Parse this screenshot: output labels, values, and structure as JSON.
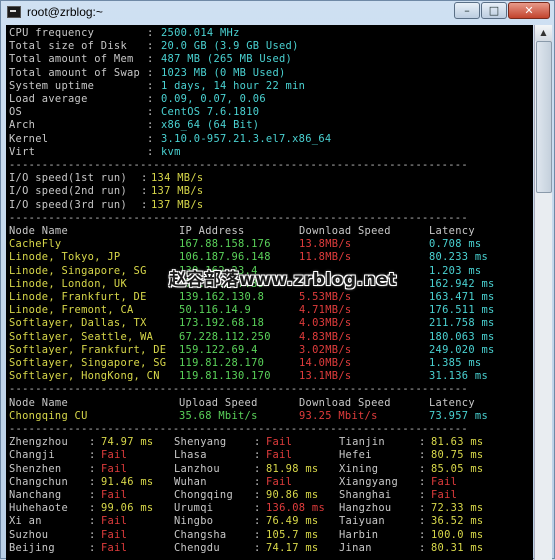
{
  "window": {
    "title": "root@zrblog:~"
  },
  "controls": {
    "minimize": "–",
    "maximize": "□",
    "close": "✕"
  },
  "sysinfo": [
    {
      "label": "CPU frequency",
      "value": "2500.014 MHz"
    },
    {
      "label": "Total size of Disk",
      "value": "20.0 GB (3.9 GB Used)"
    },
    {
      "label": "Total amount of Mem",
      "value": "487 MB (265 MB Used)"
    },
    {
      "label": "Total amount of Swap",
      "value": "1023 MB (0 MB Used)"
    },
    {
      "label": "System uptime",
      "value": "1 days, 14 hour 22 min"
    },
    {
      "label": "Load average",
      "value": "0.09, 0.07, 0.06"
    },
    {
      "label": "OS",
      "value": "CentOS 7.6.1810"
    },
    {
      "label": "Arch",
      "value": "x86_64 (64 Bit)"
    },
    {
      "label": "Kernel",
      "value": "3.10.0-957.21.3.el7.x86_64"
    },
    {
      "label": "Virt",
      "value": "kvm"
    }
  ],
  "separator": "----------------------------------------------------------------------",
  "io": [
    {
      "label": "I/O speed(1st run)",
      "value": "134 MB/s"
    },
    {
      "label": "I/O speed(2nd run)",
      "value": "137 MB/s"
    },
    {
      "label": "I/O speed(3rd run)",
      "value": "137 MB/s"
    }
  ],
  "speedtest": {
    "headers": [
      "Node Name",
      "IP Address",
      "Download Speed",
      "Latency"
    ],
    "rows": [
      [
        "CacheFly",
        "167.88.158.176",
        "13.8MB/s",
        "0.708 ms"
      ],
      [
        "Linode, Tokyo, JP",
        "106.187.96.148",
        "11.8MB/s",
        "80.233 ms"
      ],
      [
        "Linode, Singapore, SG",
        "139.162.23.4",
        "",
        "1.203 ms"
      ],
      [
        "Linode, London, UK",
        "176.58.107.39",
        "",
        "162.942 ms"
      ],
      [
        "Linode, Frankfurt, DE",
        "139.162.130.8",
        "5.53MB/s",
        "163.471 ms"
      ],
      [
        "Linode, Fremont, CA",
        "50.116.14.9",
        "4.71MB/s",
        "176.511 ms"
      ],
      [
        "Softlayer, Dallas, TX",
        "173.192.68.18",
        "4.03MB/s",
        "211.758 ms"
      ],
      [
        "Softlayer, Seattle, WA",
        "67.228.112.250",
        "4.83MB/s",
        "180.063 ms"
      ],
      [
        "Softlayer, Frankfurt, DE",
        "159.122.69.4",
        "3.02MB/s",
        "249.020 ms"
      ],
      [
        "Softlayer, Singapore, SG",
        "119.81.28.170",
        "14.0MB/s",
        "1.385 ms"
      ],
      [
        "Softlayer, HongKong, CN",
        "119.81.130.170",
        "13.1MB/s",
        "31.136 ms"
      ]
    ]
  },
  "chongqing": {
    "headers": [
      "Node Name",
      "Upload Speed",
      "Download Speed",
      "Latency"
    ],
    "row": [
      "Chongqing CU",
      "35.68 Mbit/s",
      "93.25 Mbit/s",
      "73.957 ms"
    ]
  },
  "ping": [
    [
      {
        "city": "Zhengzhou",
        "value": "74.97 ms",
        "ok": true
      },
      {
        "city": "Shenyang",
        "value": "Fail",
        "ok": false
      },
      {
        "city": "Tianjin",
        "value": "81.63 ms",
        "ok": true
      }
    ],
    [
      {
        "city": "Changji",
        "value": "Fail",
        "ok": false
      },
      {
        "city": "Lhasa",
        "value": "Fail",
        "ok": false
      },
      {
        "city": "Hefei",
        "value": "80.75 ms",
        "ok": true
      }
    ],
    [
      {
        "city": "Shenzhen",
        "value": "Fail",
        "ok": false
      },
      {
        "city": "Lanzhou",
        "value": "81.98 ms",
        "ok": true
      },
      {
        "city": "Xining",
        "value": "85.05 ms",
        "ok": true
      }
    ],
    [
      {
        "city": "Changchun",
        "value": "91.46 ms",
        "ok": true
      },
      {
        "city": "Wuhan",
        "value": "Fail",
        "ok": false
      },
      {
        "city": "Xiangyang",
        "value": "Fail",
        "ok": false
      }
    ],
    [
      {
        "city": "Nanchang",
        "value": "Fail",
        "ok": false
      },
      {
        "city": "Chongqing",
        "value": "90.86 ms",
        "ok": true
      },
      {
        "city": "Shanghai",
        "value": "Fail",
        "ok": false
      }
    ],
    [
      {
        "city": "Huhehaote",
        "value": "99.06 ms",
        "ok": true
      },
      {
        "city": "Urumqi",
        "value": "136.08 ms",
        "ok": false
      },
      {
        "city": "Hangzhou",
        "value": "72.33 ms",
        "ok": true
      }
    ],
    [
      {
        "city": "Xi an",
        "value": "Fail",
        "ok": false
      },
      {
        "city": "Ningbo",
        "value": "76.49 ms",
        "ok": true
      },
      {
        "city": "Taiyuan",
        "value": "36.52 ms",
        "ok": true
      }
    ],
    [
      {
        "city": "Suzhou",
        "value": "Fail",
        "ok": false
      },
      {
        "city": "Changsha",
        "value": "105.7 ms",
        "ok": true
      },
      {
        "city": "Harbin",
        "value": "100.0 ms",
        "ok": true
      }
    ],
    [
      {
        "city": "Beijing",
        "value": "Fail",
        "ok": false
      },
      {
        "city": "Chengdu",
        "value": "74.17 ms",
        "ok": true
      },
      {
        "city": "Jinan",
        "value": "80.31 ms",
        "ok": true
      }
    ]
  ],
  "watermark": "赵容部落www.zrblog.net",
  "colors": {
    "terminal_bg": "#000000",
    "green": "#5ad25a",
    "red": "#e03c3c",
    "yellow": "#d8d84a",
    "cyan": "#4ad2d2"
  }
}
